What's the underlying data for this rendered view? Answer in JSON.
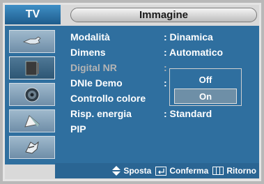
{
  "header": {
    "tv_label": "TV",
    "title": "Immagine"
  },
  "sidebar": {
    "items": [
      {
        "icon": "input-plug-icon",
        "active": false
      },
      {
        "icon": "picture-icon",
        "active": true
      },
      {
        "icon": "sound-icon",
        "active": false
      },
      {
        "icon": "channel-icon",
        "active": false
      },
      {
        "icon": "setup-icon",
        "active": false
      }
    ]
  },
  "menu": {
    "items": [
      {
        "label": "Modalità",
        "value": ": Dinamica"
      },
      {
        "label": "Dimens",
        "value": ": Automatico"
      },
      {
        "label": "Digital NR",
        "value": ":"
      },
      {
        "label": "DNIe Demo",
        "value": ":"
      },
      {
        "label": "Controllo colore",
        "value": ""
      },
      {
        "label": "Risp. energia",
        "value": ": Standard"
      },
      {
        "label": "PIP",
        "value": ""
      }
    ]
  },
  "dropdown": {
    "options": [
      "Off",
      "On"
    ],
    "selected": "On"
  },
  "footer": {
    "move": "Sposta",
    "confirm": "Conferma",
    "back": "Ritorno"
  },
  "colors": {
    "panel": "#2f6f9f",
    "frame": "#d9d9d9",
    "text": "#ffffff",
    "dim_text": "#b4b4b4"
  }
}
